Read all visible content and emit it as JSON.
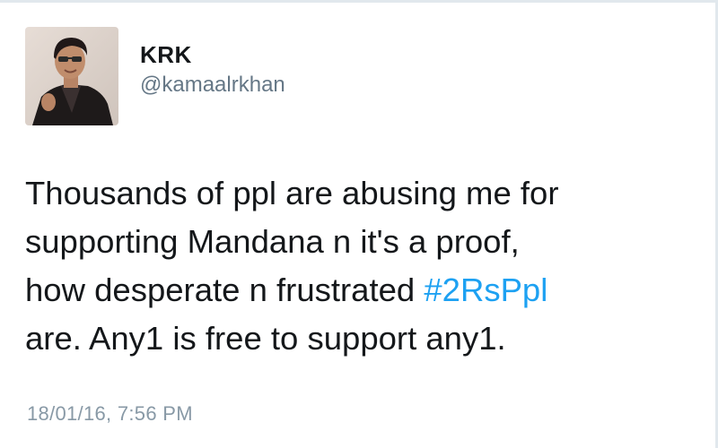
{
  "tweet": {
    "author": {
      "display_name": "KRK",
      "handle": "@kamaalrkhan"
    },
    "text": {
      "line1": "Thousands of ppl are abusing me for",
      "line2": "supporting Mandana n it's a proof,",
      "line3_before": "how desperate n frustrated ",
      "hashtag": "#2RsPpl",
      "line4": "are. Any1 is free to support any1."
    },
    "timestamp": "18/01/16, 7:56 PM"
  },
  "colors": {
    "text": "#14171a",
    "secondary": "#657786",
    "hashtag": "#1da1f2",
    "timestamp": "#8899a6"
  }
}
